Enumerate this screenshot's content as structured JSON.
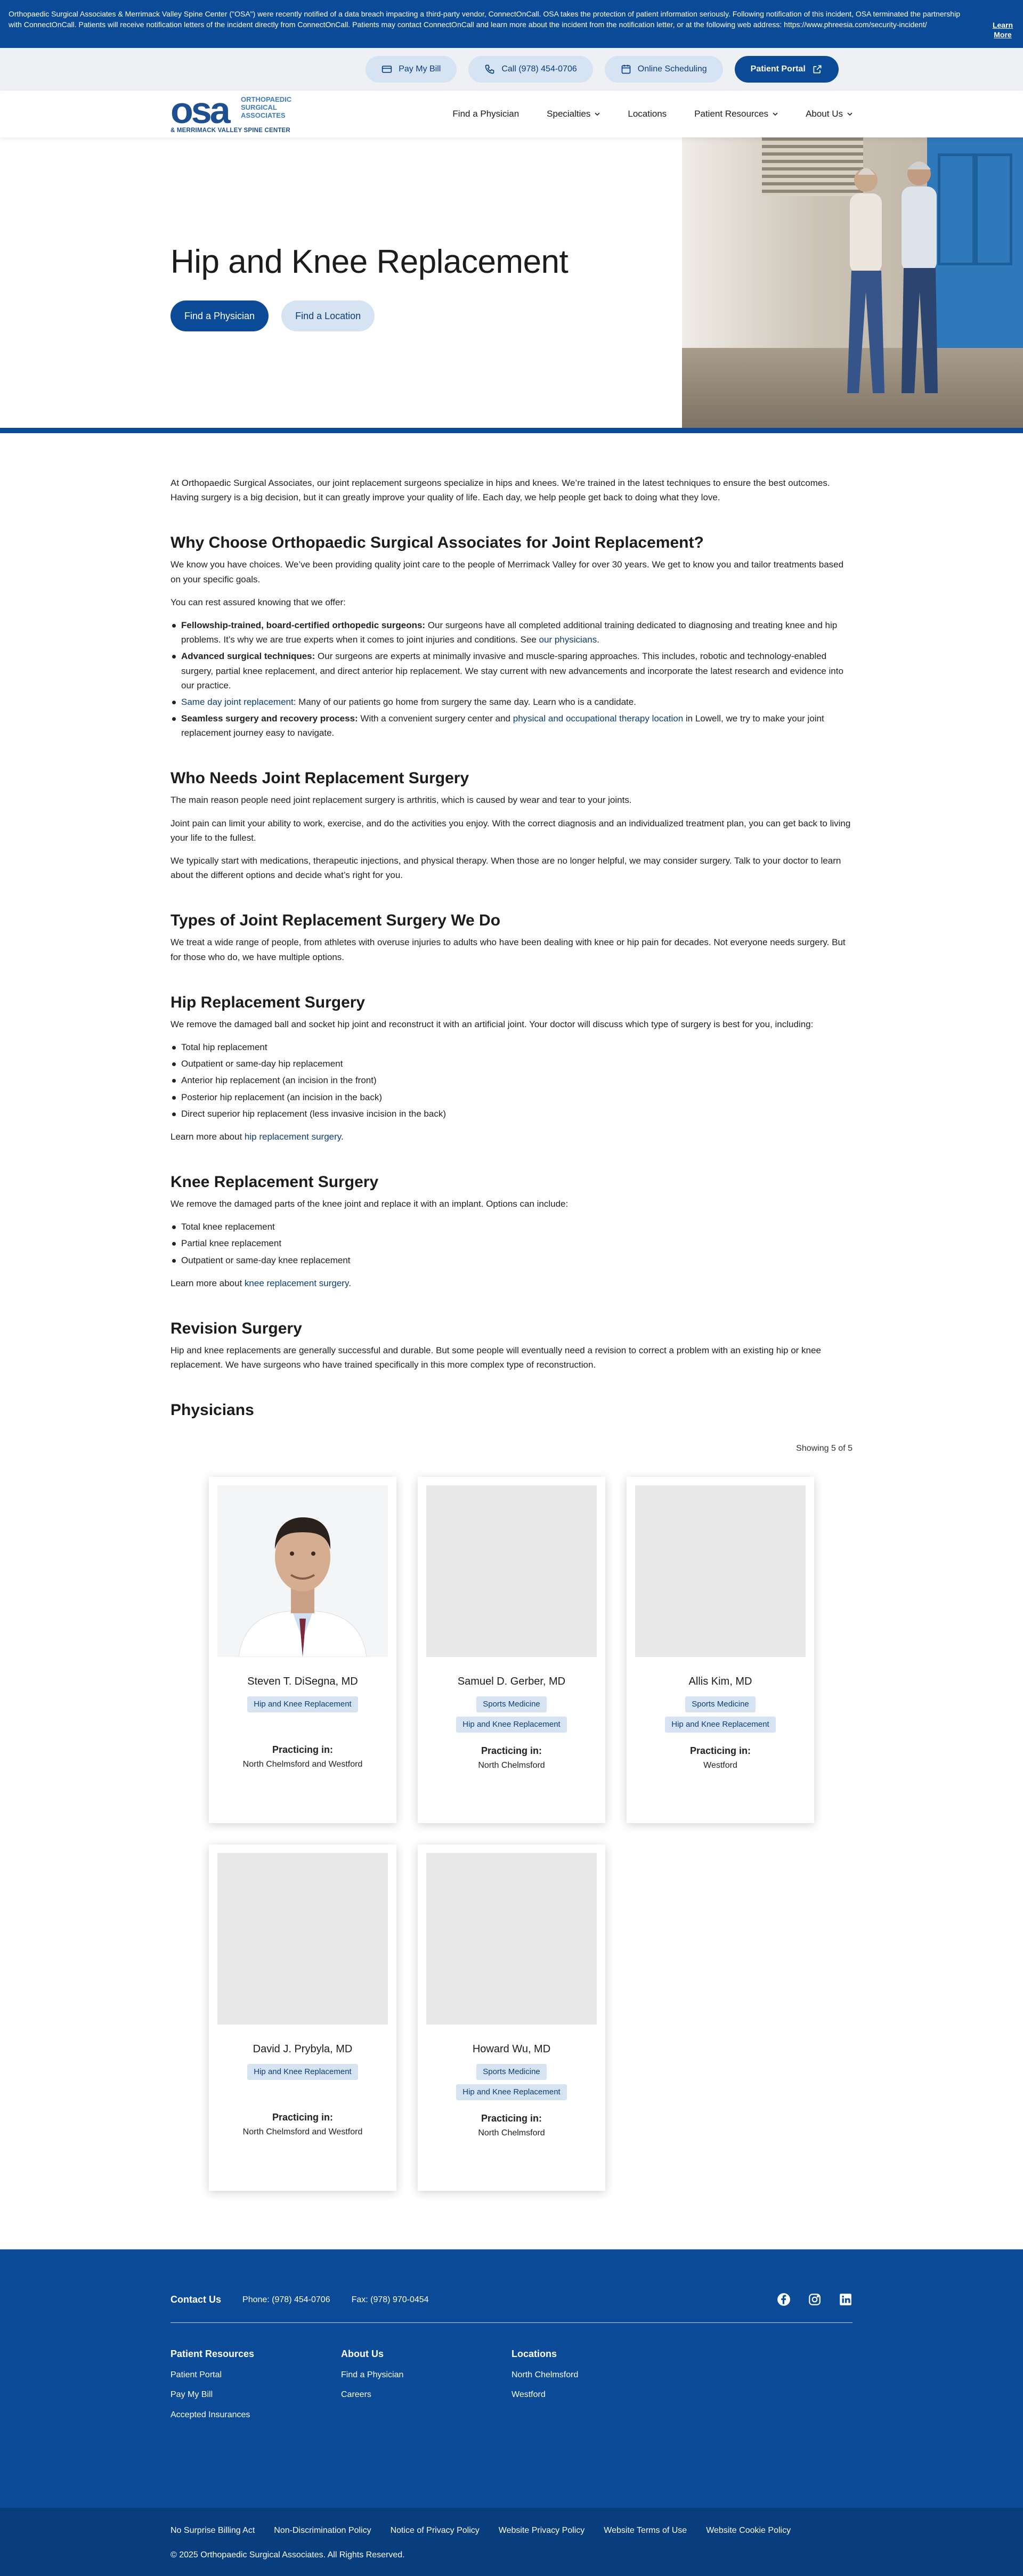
{
  "notice": {
    "text": "Orthopaedic Surgical Associates & Merrimack Valley Spine Center (\"OSA\") were recently notified of a data breach impacting a third-party vendor, ConnectOnCall. OSA takes the protection of patient information seriously. Following notification of this incident, OSA terminated the partnership with ConnectOnCall. Patients will receive notification letters of the incident directly from ConnectOnCall. Patients may contact ConnectOnCall and learn more about the incident from the notification letter, or at the following web address: https://www.phreesia.com/security-incident/",
    "learn_more": "Learn More"
  },
  "utility": {
    "pay_bill": "Pay My Bill",
    "call": "Call (978) 454-0706",
    "scheduling": "Online Scheduling",
    "portal": "Patient Portal"
  },
  "logo": {
    "mark": "osa",
    "line1": "ORTHOPAEDIC",
    "line2": "SURGICAL",
    "line3": "ASSOCIATES",
    "sub": "& MERRIMACK VALLEY SPINE CENTER"
  },
  "nav": {
    "find_physician": "Find a Physician",
    "specialties": "Specialties",
    "locations": "Locations",
    "patient_resources": "Patient Resources",
    "about": "About Us"
  },
  "hero": {
    "title": "Hip and Knee Replacement",
    "btn_physician": "Find a Physician",
    "btn_location": "Find a Location"
  },
  "intro": "At Orthopaedic Surgical Associates, our joint replacement surgeons specialize in hips and knees. We’re trained in the latest techniques to ensure the best outcomes. Having surgery is a big decision, but it can greatly improve your quality of life. Each day, we help people get back to doing what they love.",
  "why": {
    "title": "Why Choose Orthopaedic Surgical Associates for Joint Replacement?",
    "p1": "We know you have choices. We’ve been providing quality joint care to the people of Merrimack Valley for over 30 years. We get to know you and tailor treatments based on your specific goals.",
    "p2": "You can rest assured knowing that we offer:",
    "b1_title": "Fellowship-trained, board-certified orthopedic surgeons:",
    "b1_text": " Our surgeons have all completed additional training dedicated to diagnosing and treating knee and hip problems. It’s why we are true experts when it comes to joint injuries and conditions. See ",
    "b1_link": "our physicians",
    "b1_end": ".",
    "b2_title": "Advanced surgical techniques:",
    "b2_text": " Our surgeons are experts at minimally invasive and muscle-sparing approaches. This includes, robotic and technology-enabled surgery, partial knee replacement, and direct anterior hip replacement. We stay current with new advancements and incorporate the latest research and evidence into our practice.",
    "b3_link": "Same day joint replacement",
    "b3_text": ": Many of our patients go home from surgery the same day. Learn who is a candidate.",
    "b4_title": "Seamless surgery and recovery process:",
    "b4_text": " With a convenient surgery center and ",
    "b4_link": "physical and occupational therapy location",
    "b4_end": " in Lowell, we try to make your joint replacement journey easy to navigate."
  },
  "who": {
    "title": "Who Needs Joint Replacement Surgery",
    "p1": "The main reason people need joint replacement surgery is arthritis, which is caused by wear and tear to your joints.",
    "p2": "Joint pain can limit your ability to work, exercise, and do the activities you enjoy. With the correct diagnosis and an individualized treatment plan, you can get back to living your life to the fullest.",
    "p3": "We typically start with medications, therapeutic injections, and physical therapy. When those are no longer helpful, we may consider surgery. Talk to your doctor to learn about the different options and decide what’s right for you."
  },
  "types": {
    "title": "Types of Joint Replacement Surgery We Do",
    "p1": "We treat a wide range of people, from athletes with overuse injuries to adults who have been dealing with knee or hip pain for decades. Not everyone needs surgery. But for those who do, we have multiple options."
  },
  "hip": {
    "title": "Hip Replacement Surgery",
    "p1": "We remove the damaged ball and socket hip joint and reconstruct it with an artificial joint. Your doctor will discuss which type of surgery is best for you, including:",
    "items": [
      "Total hip replacement",
      "Outpatient or same-day hip replacement",
      "Anterior hip replacement (an incision in the front)",
      "Posterior hip replacement (an incision in the back)",
      "Direct superior hip replacement (less invasive incision in the back)"
    ],
    "more": "Learn more about ",
    "link": "hip replacement surgery",
    "end": "."
  },
  "knee": {
    "title": "Knee Replacement Surgery",
    "p1": "We remove the damaged parts of the knee joint and replace it with an implant. Options can include:",
    "items": [
      "Total knee replacement",
      "Partial knee replacement",
      "Outpatient or same-day knee replacement"
    ],
    "more": "Learn more about ",
    "link": "knee replacement surgery",
    "end": "."
  },
  "revision": {
    "title": "Revision Surgery",
    "p1": "Hip and knee replacements are generally successful and durable. But some people will eventually need a revision to correct a problem with an existing hip or knee replacement. We have surgeons who have trained specifically in this more complex type of reconstruction."
  },
  "physicians": {
    "title": "Physicians",
    "showing": "Showing 5 of 5",
    "practicing": "Practicing in:",
    "list": [
      {
        "name": "Steven T. DiSegna, MD",
        "tags": [
          "Hip and Knee Replacement"
        ],
        "locations": "North Chelmsford and Westford"
      },
      {
        "name": "Samuel D. Gerber, MD",
        "tags": [
          "Sports Medicine",
          "Hip and Knee Replacement"
        ],
        "locations": "North Chelmsford"
      },
      {
        "name": "Allis Kim, MD",
        "tags": [
          "Sports Medicine",
          "Hip and Knee Replacement"
        ],
        "locations": "Westford"
      },
      {
        "name": "David J. Prybyla, MD",
        "tags": [
          "Hip and Knee Replacement"
        ],
        "locations": "North Chelmsford and Westford"
      },
      {
        "name": "Howard Wu, MD",
        "tags": [
          "Sports Medicine",
          "Hip and Knee Replacement"
        ],
        "locations": "North Chelmsford"
      }
    ]
  },
  "footer": {
    "contact_label": "Contact Us",
    "phone": "Phone: (978) 454-0706",
    "fax": "Fax: (978) 970-0454",
    "col1_title": "Patient Resources",
    "col1": [
      "Patient Portal",
      "Pay My Bill",
      "Accepted Insurances"
    ],
    "col2_title": "About Us",
    "col2": [
      "Find a Physician",
      "Careers"
    ],
    "col3_title": "Locations",
    "col3": [
      "North Chelmsford",
      "Westford"
    ],
    "legal": [
      "No Surprise Billing Act",
      "Non-Discrimination Policy",
      "Notice of Privacy Policy",
      "Website Privacy Policy",
      "Website Terms of Use",
      "Website Cookie Policy"
    ],
    "copyright": "© 2025 Orthopaedic Surgical Associates. All Rights Reserved."
  },
  "colors": {
    "brand_blue": "#0b4a96",
    "light_blue": "#d6e3f3"
  }
}
